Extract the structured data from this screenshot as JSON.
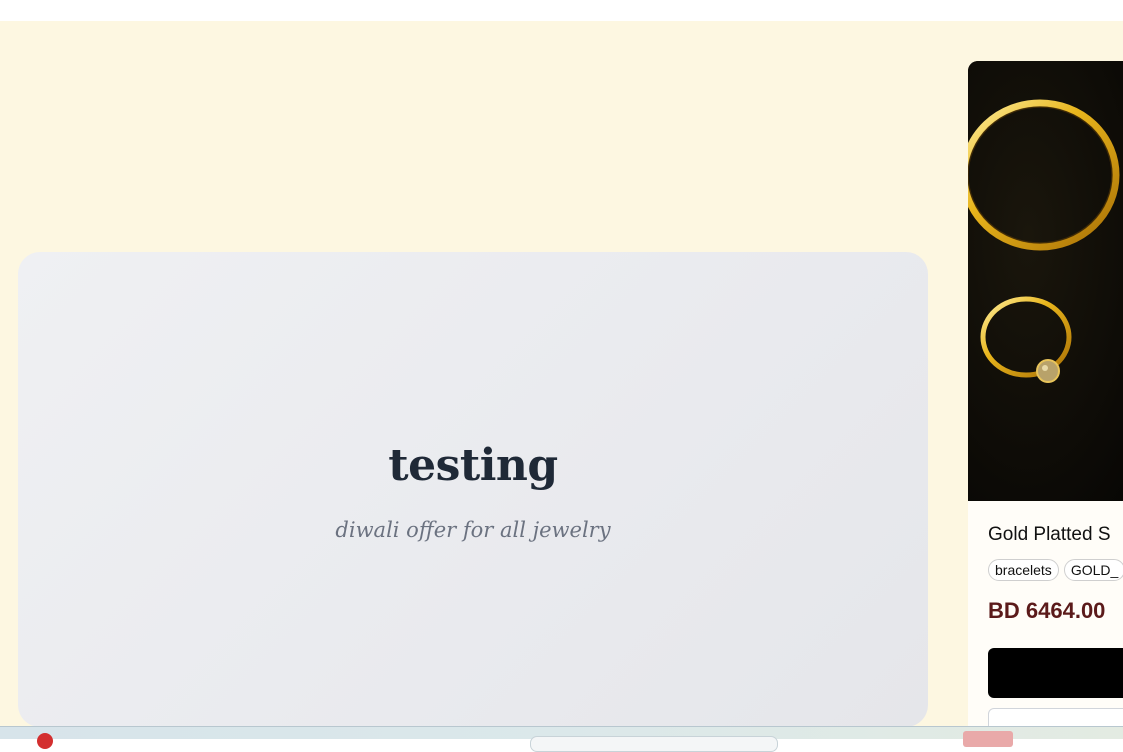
{
  "banner": {
    "title": "testing",
    "subtitle": "diwali offer for all jewelry"
  },
  "product": {
    "title": "Gold Platted S",
    "tags": [
      "bracelets",
      "GOLD_"
    ],
    "price": "BD 6464.00",
    "image_icon": "gold-bangle-and-ring-image"
  },
  "colors": {
    "section_bg": "#fdf7e1",
    "banner_bg": "#eceef1",
    "price": "#5b1a1a",
    "button": "#000000"
  }
}
